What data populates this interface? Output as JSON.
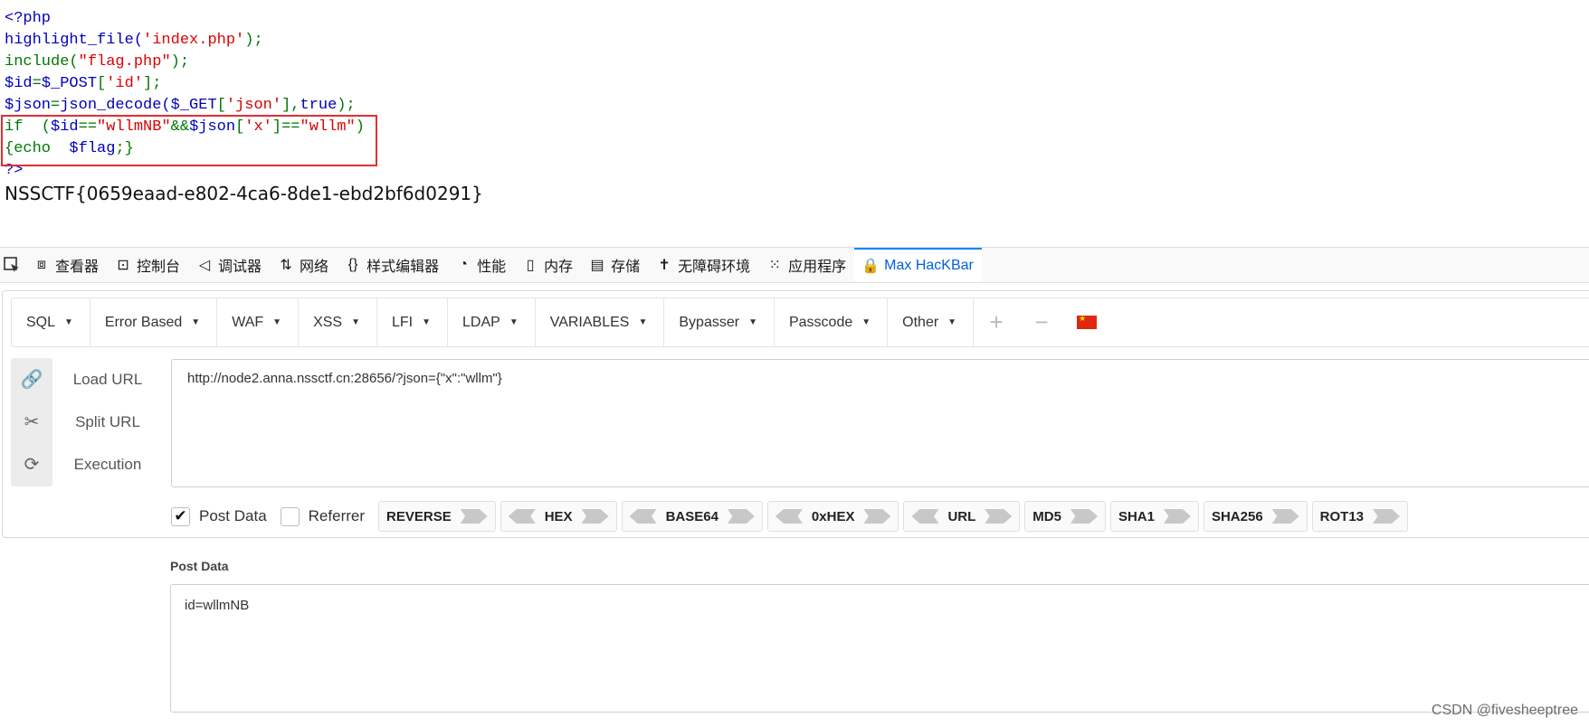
{
  "source": {
    "lines": [
      [
        {
          "t": "<?php",
          "c": "c-blue"
        }
      ],
      [
        {
          "t": "highlight_file(",
          "c": "c-blue"
        },
        {
          "t": "'index.php'",
          "c": "c-red"
        },
        {
          "t": ");",
          "c": "c-green"
        }
      ],
      [
        {
          "t": "include(",
          "c": "c-green"
        },
        {
          "t": "\"flag.php\"",
          "c": "c-red"
        },
        {
          "t": ");",
          "c": "c-green"
        }
      ],
      [
        {
          "t": "$id",
          "c": "c-blue"
        },
        {
          "t": "=",
          "c": "c-green"
        },
        {
          "t": "$_POST",
          "c": "c-blue"
        },
        {
          "t": "[",
          "c": "c-green"
        },
        {
          "t": "'id'",
          "c": "c-red"
        },
        {
          "t": "];",
          "c": "c-green"
        }
      ],
      [
        {
          "t": "$json",
          "c": "c-blue"
        },
        {
          "t": "=",
          "c": "c-green"
        },
        {
          "t": "json_decode(",
          "c": "c-blue"
        },
        {
          "t": "$_GET",
          "c": "c-blue"
        },
        {
          "t": "[",
          "c": "c-green"
        },
        {
          "t": "'json'",
          "c": "c-red"
        },
        {
          "t": "],",
          "c": "c-green"
        },
        {
          "t": "true",
          "c": "c-blue"
        },
        {
          "t": ");",
          "c": "c-green"
        }
      ],
      [
        {
          "t": "if  (",
          "c": "c-green"
        },
        {
          "t": "$id",
          "c": "c-blue"
        },
        {
          "t": "==",
          "c": "c-green"
        },
        {
          "t": "\"wllmNB\"",
          "c": "c-red"
        },
        {
          "t": "&&",
          "c": "c-green"
        },
        {
          "t": "$json",
          "c": "c-blue"
        },
        {
          "t": "[",
          "c": "c-green"
        },
        {
          "t": "'x'",
          "c": "c-red"
        },
        {
          "t": "]==",
          "c": "c-green"
        },
        {
          "t": "\"wllm\"",
          "c": "c-red"
        },
        {
          "t": ")",
          "c": "c-green"
        }
      ],
      [
        {
          "t": "{echo  ",
          "c": "c-green"
        },
        {
          "t": "$flag",
          "c": "c-blue"
        },
        {
          "t": ";}",
          "c": "c-green"
        }
      ],
      [
        {
          "t": "?>",
          "c": "c-blue"
        }
      ]
    ],
    "flag": "NSSCTF{0659eaad-e802-4ca6-8de1-ebd2bf6d0291}"
  },
  "devtools": {
    "tabs": [
      {
        "name": "tab-inspector",
        "icon": "inspector-icon",
        "glyph": "⧈",
        "label": "查看器"
      },
      {
        "name": "tab-console",
        "icon": "console-icon",
        "glyph": "⊡",
        "label": "控制台"
      },
      {
        "name": "tab-debugger",
        "icon": "debugger-icon",
        "glyph": "◁",
        "label": "调试器"
      },
      {
        "name": "tab-network",
        "icon": "network-icon",
        "glyph": "⇅",
        "label": "网络"
      },
      {
        "name": "tab-style-editor",
        "icon": "braces-icon",
        "glyph": "{}",
        "label": "样式编辑器"
      },
      {
        "name": "tab-performance",
        "icon": "gauge-icon",
        "glyph": "◔",
        "label": "性能"
      },
      {
        "name": "tab-memory",
        "icon": "memory-chip-icon",
        "glyph": "▯",
        "label": "内存"
      },
      {
        "name": "tab-storage",
        "icon": "storage-icon",
        "glyph": "▤",
        "label": "存储"
      },
      {
        "name": "tab-accessibility",
        "icon": "accessibility-icon",
        "glyph": "✝",
        "label": "无障碍环境"
      },
      {
        "name": "tab-application",
        "icon": "grid-icon",
        "glyph": "⁙",
        "label": "应用程序"
      },
      {
        "name": "tab-max-hackbar",
        "icon": "lock-icon",
        "glyph": "🔒",
        "label": "Max HacKBar",
        "active": true
      }
    ]
  },
  "hackbar": {
    "menus": [
      "SQL",
      "Error Based",
      "WAF",
      "XSS",
      "LFI",
      "LDAP",
      "VARIABLES",
      "Bypasser",
      "Passcode",
      "Other"
    ],
    "tools": {
      "add": "+",
      "remove": "−"
    },
    "actions": [
      {
        "name": "load-url",
        "icon": "link-icon",
        "glyph": "🔗",
        "label": "Load URL"
      },
      {
        "name": "split-url",
        "icon": "scissors-icon",
        "glyph": "✂",
        "label": "Split URL"
      },
      {
        "name": "execution",
        "icon": "refresh-icon",
        "glyph": "⟳",
        "label": "Execution"
      }
    ],
    "url": "http://node2.anna.nssctf.cn:28656/?json={\"x\":\"wllm\"}",
    "options": {
      "post_data": {
        "label": "Post Data",
        "checked": true
      },
      "referrer": {
        "label": "Referrer",
        "checked": false
      }
    },
    "encoders": [
      {
        "label": "REVERSE",
        "left": false,
        "right": true
      },
      {
        "label": "HEX",
        "left": true,
        "right": true
      },
      {
        "label": "BASE64",
        "left": true,
        "right": true
      },
      {
        "label": "0xHEX",
        "left": true,
        "right": true
      },
      {
        "label": "URL",
        "left": true,
        "right": true
      },
      {
        "label": "MD5",
        "left": false,
        "right": true
      },
      {
        "label": "SHA1",
        "left": false,
        "right": true
      },
      {
        "label": "SHA256",
        "left": false,
        "right": true
      },
      {
        "label": "ROT13",
        "left": false,
        "right": true
      }
    ],
    "post_label": "Post Data",
    "post_body": "id=wllmNB"
  },
  "watermark": "CSDN @fivesheeptree",
  "colors": {
    "accent": "#0a84ff",
    "highlight_box": "#e03030"
  }
}
